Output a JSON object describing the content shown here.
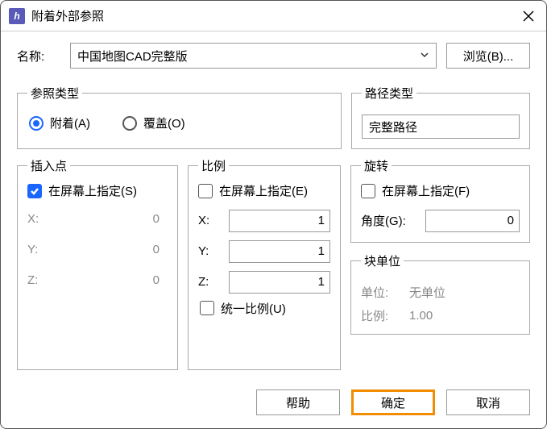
{
  "title": "附着外部参照",
  "name_label": "名称:",
  "name_value": "中国地图CAD完整版",
  "browse_label": "浏览(B)...",
  "reftype": {
    "legend": "参照类型",
    "attach": "附着(A)",
    "overlay": "覆盖(O)"
  },
  "pathtype": {
    "legend": "路径类型",
    "value": "完整路径"
  },
  "insert": {
    "legend": "插入点",
    "specify": "在屏幕上指定(S)",
    "x_label": "X:",
    "y_label": "Y:",
    "z_label": "Z:",
    "x": "0",
    "y": "0",
    "z": "0"
  },
  "scale": {
    "legend": "比例",
    "specify": "在屏幕上指定(E)",
    "x_label": "X:",
    "y_label": "Y:",
    "z_label": "Z:",
    "x": "1",
    "y": "1",
    "z": "1",
    "uniform": "统一比例(U)"
  },
  "rotation": {
    "legend": "旋转",
    "specify": "在屏幕上指定(F)",
    "angle_label": "角度(G):",
    "angle": "0"
  },
  "unit": {
    "legend": "块单位",
    "unit_label": "单位:",
    "unit_value": "无单位",
    "scale_label": "比例:",
    "scale_value": "1.00"
  },
  "buttons": {
    "help": "帮助",
    "ok": "确定",
    "cancel": "取消"
  }
}
